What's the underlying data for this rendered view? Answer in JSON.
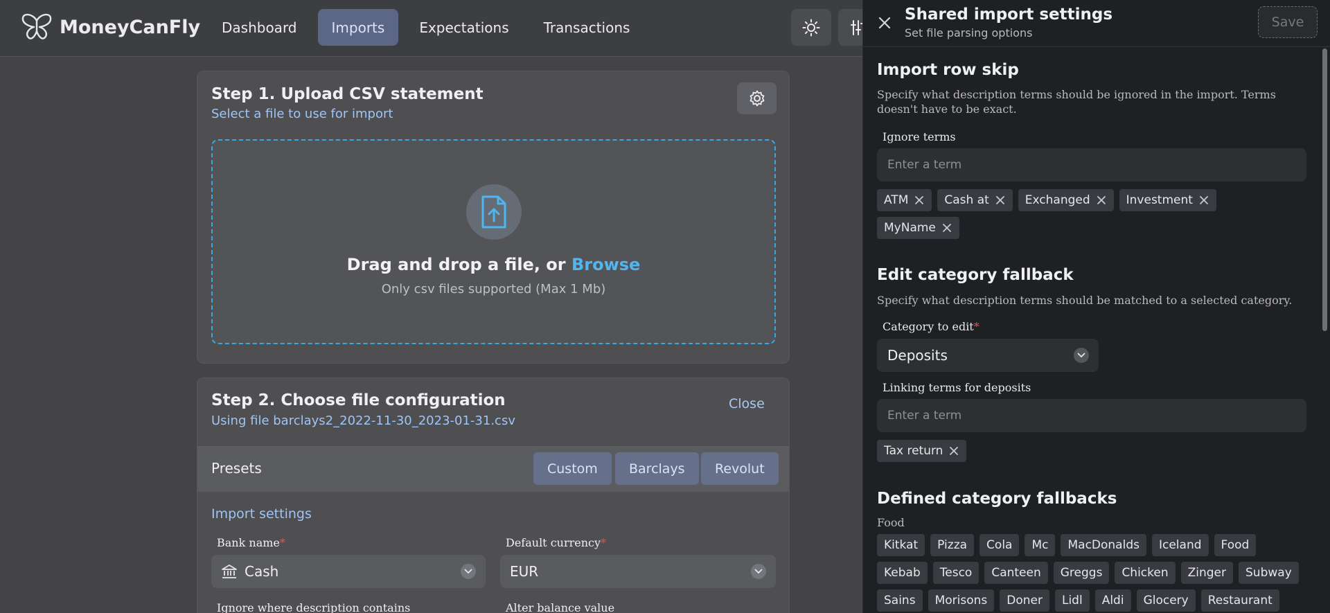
{
  "app": {
    "name": "MoneyCanFly",
    "nav": [
      "Dashboard",
      "Imports",
      "Expectations",
      "Transactions"
    ],
    "active_nav": "Imports"
  },
  "step1": {
    "title": "Step 1. Upload CSV statement",
    "subtitle": "Select a file to use for import",
    "drop_text": "Drag and drop a file, or",
    "browse_label": "Browse",
    "drop_hint": "Only csv files supported (Max 1 Mb)"
  },
  "step2": {
    "title": "Step 2. Choose file configuration",
    "subtitle": "Using file barclays2_2022-11-30_2023-01-31.csv",
    "close_label": "Close",
    "presets_label": "Presets",
    "presets": [
      "Custom",
      "Barclays",
      "Revolut"
    ],
    "import_settings_label": "Import settings",
    "bank_name_label": "Bank name",
    "bank_name_value": "Cash",
    "currency_label": "Default currency",
    "currency_value": "EUR",
    "ignore_label": "Ignore where description contains",
    "alter_label": "Alter balance value"
  },
  "drawer": {
    "title": "Shared import settings",
    "subtitle": "Set file parsing options",
    "save_label": "Save",
    "row_skip": {
      "heading": "Import row skip",
      "description": "Specify what description terms should be ignored in the import. Terms doesn't have to be exact.",
      "label": "Ignore terms",
      "placeholder": "Enter a term",
      "terms": [
        "ATM",
        "Cash at",
        "Exchanged",
        "Investment",
        "MyName"
      ]
    },
    "fallback": {
      "heading": "Edit category fallback",
      "description": "Specify what description terms should be matched to a selected category.",
      "category_label": "Category to edit",
      "category_value": "Deposits",
      "linking_label": "Linking terms for deposits",
      "placeholder": "Enter a term",
      "terms": [
        "Tax return"
      ]
    },
    "defined": {
      "heading": "Defined category fallbacks",
      "group_label": "Food",
      "terms": [
        "Kitkat",
        "Pizza",
        "Cola",
        "Mc",
        "MacDonalds",
        "Iceland",
        "Food",
        "Kebab",
        "Tesco",
        "Canteen",
        "Greggs",
        "Chicken",
        "Zinger",
        "Subway",
        "Sains",
        "Morisons",
        "Doner",
        "Lidl",
        "Aldi",
        "Glocery",
        "Restaurant"
      ]
    }
  },
  "colors": {
    "accent": "#4fb6ef",
    "active_nav": "#5b6785",
    "required": "#e0555a",
    "drawer_bg": "#1f2023"
  }
}
